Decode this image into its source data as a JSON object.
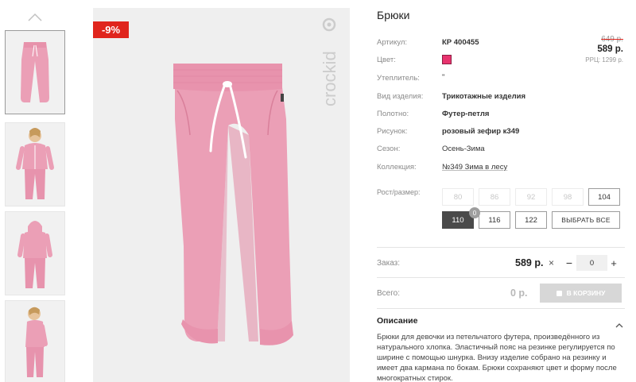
{
  "gallery": {
    "thumbnails": [
      {
        "label": "pants-front"
      },
      {
        "label": "model-front"
      },
      {
        "label": "model-back"
      },
      {
        "label": "model-side"
      }
    ],
    "discount_badge": "-9%",
    "brand_logo": "crockid"
  },
  "product": {
    "title": "Брюки",
    "price": {
      "old": "649 р.",
      "new": "589 р.",
      "rrp": "РРЦ: 1299 р."
    },
    "attributes": [
      {
        "label": "Артикул:",
        "value": "КР 400455",
        "style": "bold"
      },
      {
        "label": "Цвет:",
        "value": "",
        "style": "swatch"
      },
      {
        "label": "Утеплитель:",
        "value": "\"",
        "style": "plain"
      },
      {
        "label": "Вид изделия:",
        "value": "Трикотажные изделия",
        "style": "bold"
      },
      {
        "label": "Полотно:",
        "value": "Футер-петля",
        "style": "bold"
      },
      {
        "label": "Рисунок:",
        "value": "розовый зефир к349",
        "style": "bold"
      },
      {
        "label": "Сезон:",
        "value": "Осень-Зима",
        "style": "plain"
      },
      {
        "label": "Коллекция:",
        "value": "№349 Зима в лесу",
        "style": "link"
      }
    ],
    "color_swatch": "#e8336e"
  },
  "sizes": {
    "label": "Рост/размер:",
    "row1": [
      {
        "label": "80",
        "state": "disabled"
      },
      {
        "label": "86",
        "state": "disabled"
      },
      {
        "label": "92",
        "state": "disabled"
      },
      {
        "label": "98",
        "state": "disabled"
      },
      {
        "label": "104",
        "state": "outline"
      }
    ],
    "row2": [
      {
        "label": "110",
        "state": "selected"
      },
      {
        "label": "116",
        "state": "outline"
      },
      {
        "label": "122",
        "state": "outline"
      }
    ],
    "select_all": "ВЫБРАТЬ ВСЕ",
    "badge": "0"
  },
  "order": {
    "label": "Заказ:",
    "price": "589 р.",
    "times": "×",
    "minus": "−",
    "quantity": "0",
    "plus": "+"
  },
  "total": {
    "label": "Всего:",
    "value": "0 р.",
    "cart_button": "В КОРЗИНУ"
  },
  "description": {
    "heading": "Описание",
    "text": "Брюки для девочки из петельчатого футера, произведённого из натурального хлопка. Эластичный пояс на резинке регулируется по ширине с помощью шнурка. Внизу изделие собрано на резинку и имеет два кармана по бокам. Брюки сохраняют цвет и форму после многократных стирок."
  },
  "colors": {
    "accent_red": "#e0251d",
    "pink": "#e8336e",
    "garment": "#eb9fb6"
  }
}
